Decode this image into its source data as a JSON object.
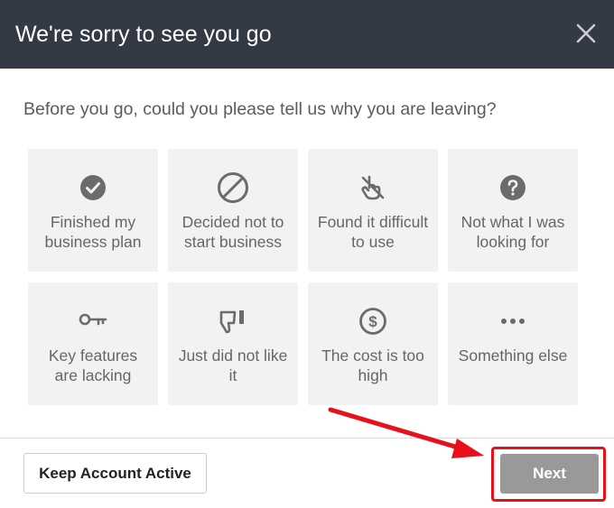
{
  "dialog": {
    "title": "We're sorry to see you go",
    "close_icon": "close-icon",
    "prompt": "Before you go, could you please tell us why you are leaving?"
  },
  "reasons": [
    {
      "icon": "check-circle-icon",
      "label": "Finished my business plan"
    },
    {
      "icon": "no-entry-icon",
      "label": "Decided not to start business"
    },
    {
      "icon": "hand-pointer-icon",
      "label": "Found it difficult to use"
    },
    {
      "icon": "question-circle-icon",
      "label": "Not what I was looking for"
    },
    {
      "icon": "key-icon",
      "label": "Key features are lacking"
    },
    {
      "icon": "thumbs-down-icon",
      "label": "Just did not like it"
    },
    {
      "icon": "dollar-circle-icon",
      "label": "The cost is too high"
    },
    {
      "icon": "ellipsis-icon",
      "label": "Something else"
    }
  ],
  "footer": {
    "keep_label": "Keep Account Active",
    "next_label": "Next"
  },
  "colors": {
    "header_bg": "#333a45",
    "card_bg": "#f2f2f2",
    "next_bg": "#999999",
    "highlight": "#e8101a"
  }
}
